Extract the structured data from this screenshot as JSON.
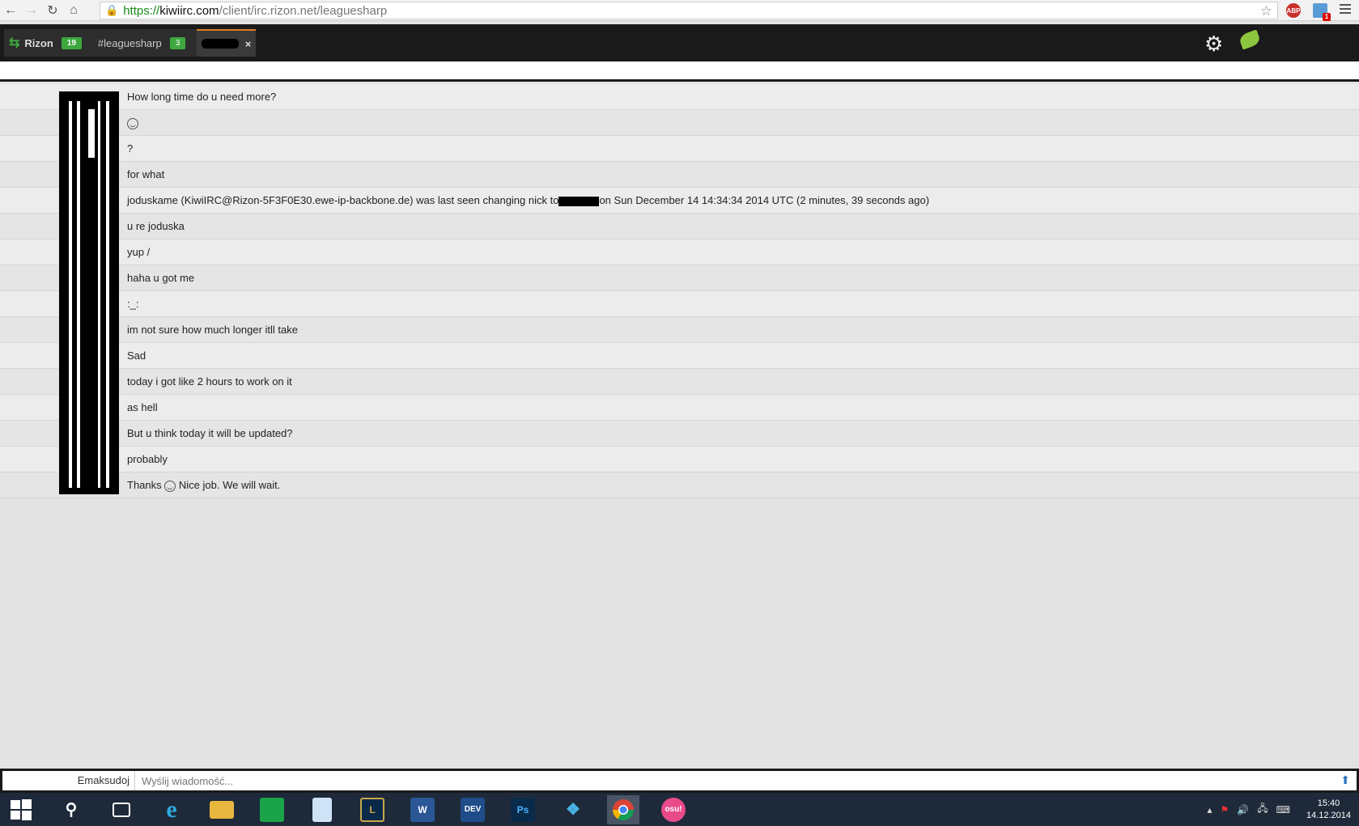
{
  "browser": {
    "url_scheme": "https://",
    "url_host": "kiwiirc.com",
    "url_path": "/client/irc.rizon.net/leaguesharp",
    "ext_abp": "ABP",
    "ext_mail_badge": "1"
  },
  "tabs": {
    "server_label": "Rizon",
    "server_count": "19",
    "channel_label": "#leaguesharp",
    "channel_count": "3",
    "close": "×"
  },
  "messages": [
    {
      "text": "How long time do u need more?"
    },
    {
      "text": ""
    },
    {
      "text": "?"
    },
    {
      "text": "for what"
    },
    {
      "text_before": "joduskame (KiwiIRC@Rizon-5F3F0E30.ewe-ip-backbone.de) was last seen changing nick to",
      "text_after": "on Sun December 14 14:34:34 2014 UTC (2 minutes, 39 seconds ago)"
    },
    {
      "text": "u re joduska"
    },
    {
      "text": "yup /"
    },
    {
      "text": "haha u got me"
    },
    {
      "text": ":_:"
    },
    {
      "text": "im not sure how much longer itll take"
    },
    {
      "text": "Sad"
    },
    {
      "text": "today i got like 2 hours to work on it"
    },
    {
      "text": "as hell"
    },
    {
      "text": "But u think today it will be updated?"
    },
    {
      "text": "probably"
    },
    {
      "text_before": "Thanks",
      "text_after": "Nice job. We will wait."
    }
  ],
  "input": {
    "nick": "Emaksudoj",
    "placeholder": "Wyślij wiadomość..."
  },
  "taskbar": {
    "apps": [
      "Start",
      "Search",
      "Task View",
      "Internet Explorer",
      "File Explorer",
      "Store",
      "Notepad",
      "League of Legends",
      "Word",
      "Dev-C++",
      "Photoshop",
      "StepMania",
      "Chrome",
      "osu!"
    ],
    "dev_label": "DEV",
    "ps_label": "Ps",
    "osu_label": "osu!",
    "time": "15:40",
    "date": "14.12.2014"
  }
}
